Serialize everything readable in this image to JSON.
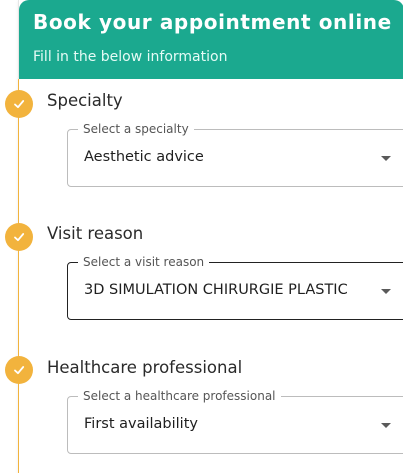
{
  "header": {
    "title": "Book your appointment online",
    "subtitle": "Fill in the below information"
  },
  "steps": [
    {
      "title": "Specialty",
      "field_label": "Select a specialty",
      "value": "Aesthetic advice",
      "completed": true
    },
    {
      "title": "Visit reason",
      "field_label": "Select a visit reason",
      "value": "3D SIMULATION CHIRURGIE PLASTIC",
      "completed": true
    },
    {
      "title": "Healthcare professional",
      "field_label": "Select a healthcare professional",
      "value": "First availability",
      "completed": true
    }
  ],
  "icons": {
    "step_status": "check-icon",
    "dropdown": "caret-down-icon"
  },
  "colors": {
    "header_background": "#1ba98f",
    "timeline_accent": "#f2b33d"
  }
}
